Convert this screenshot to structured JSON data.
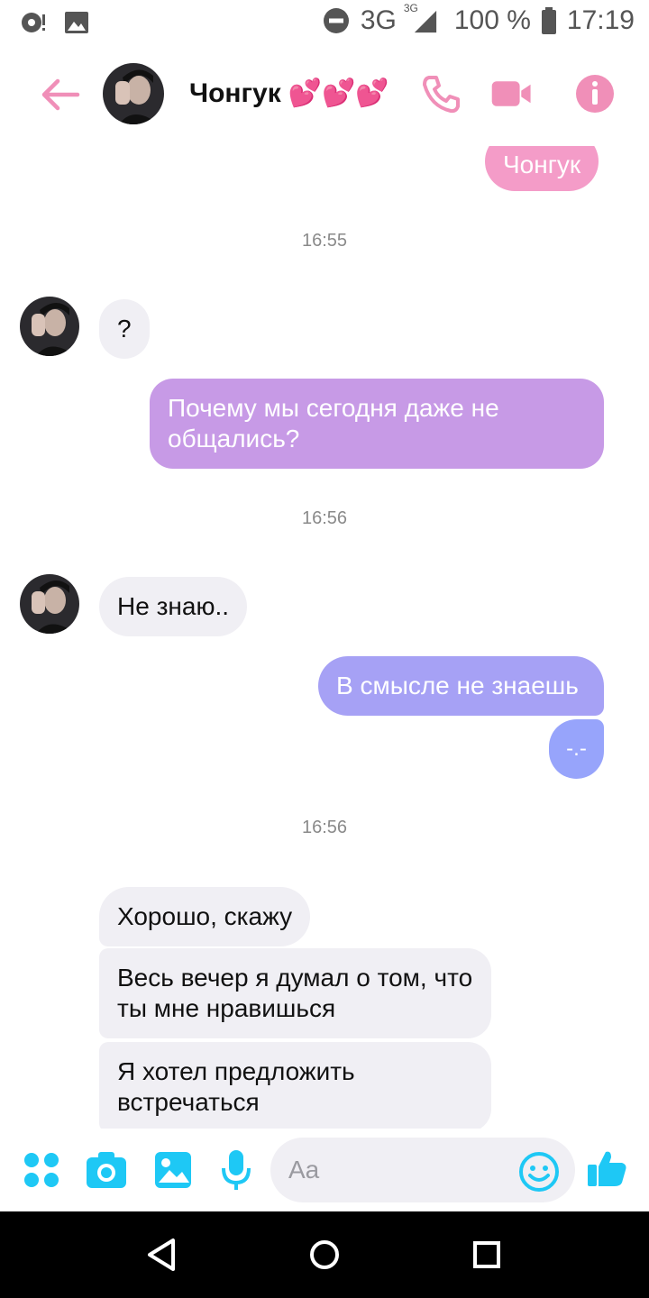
{
  "status_bar": {
    "network": "3G",
    "network_small": "3G",
    "battery": "100 %",
    "time": "17:19"
  },
  "header": {
    "contact_name": "Чонгук",
    "hearts": "💕💕💕",
    "icons": [
      "back-arrow-icon",
      "phone-icon",
      "video-camera-icon",
      "info-icon"
    ],
    "accent_color": "#f08fb8"
  },
  "messages": [
    {
      "type": "out",
      "text": "Чонгук",
      "color": "#f49cc8"
    },
    {
      "type": "time",
      "text": "16:55"
    },
    {
      "type": "in",
      "text": "?"
    },
    {
      "type": "out",
      "text": "Почему мы сегодня даже не общались?",
      "color": "#c79ae6"
    },
    {
      "type": "time",
      "text": "16:56"
    },
    {
      "type": "in",
      "text": "Не знаю.."
    },
    {
      "type": "out",
      "text": "В смысле не знаешь",
      "color": "#a6a1f5"
    },
    {
      "type": "out",
      "text": "-.-",
      "color": "#97a4fb"
    },
    {
      "type": "time",
      "text": "16:56"
    },
    {
      "type": "in",
      "text": "Хорошо, скажу"
    },
    {
      "type": "in",
      "text": "Весь вечер я думал о том, что ты мне нравишься"
    },
    {
      "type": "in",
      "text": "Я хотел предложить встречаться"
    }
  ],
  "input_bar": {
    "placeholder": "Aa",
    "icons": [
      "apps-grid-icon",
      "camera-icon",
      "gallery-icon",
      "microphone-icon",
      "emoji-icon",
      "thumbs-up-icon"
    ],
    "accent_color": "#1ec8f5"
  }
}
